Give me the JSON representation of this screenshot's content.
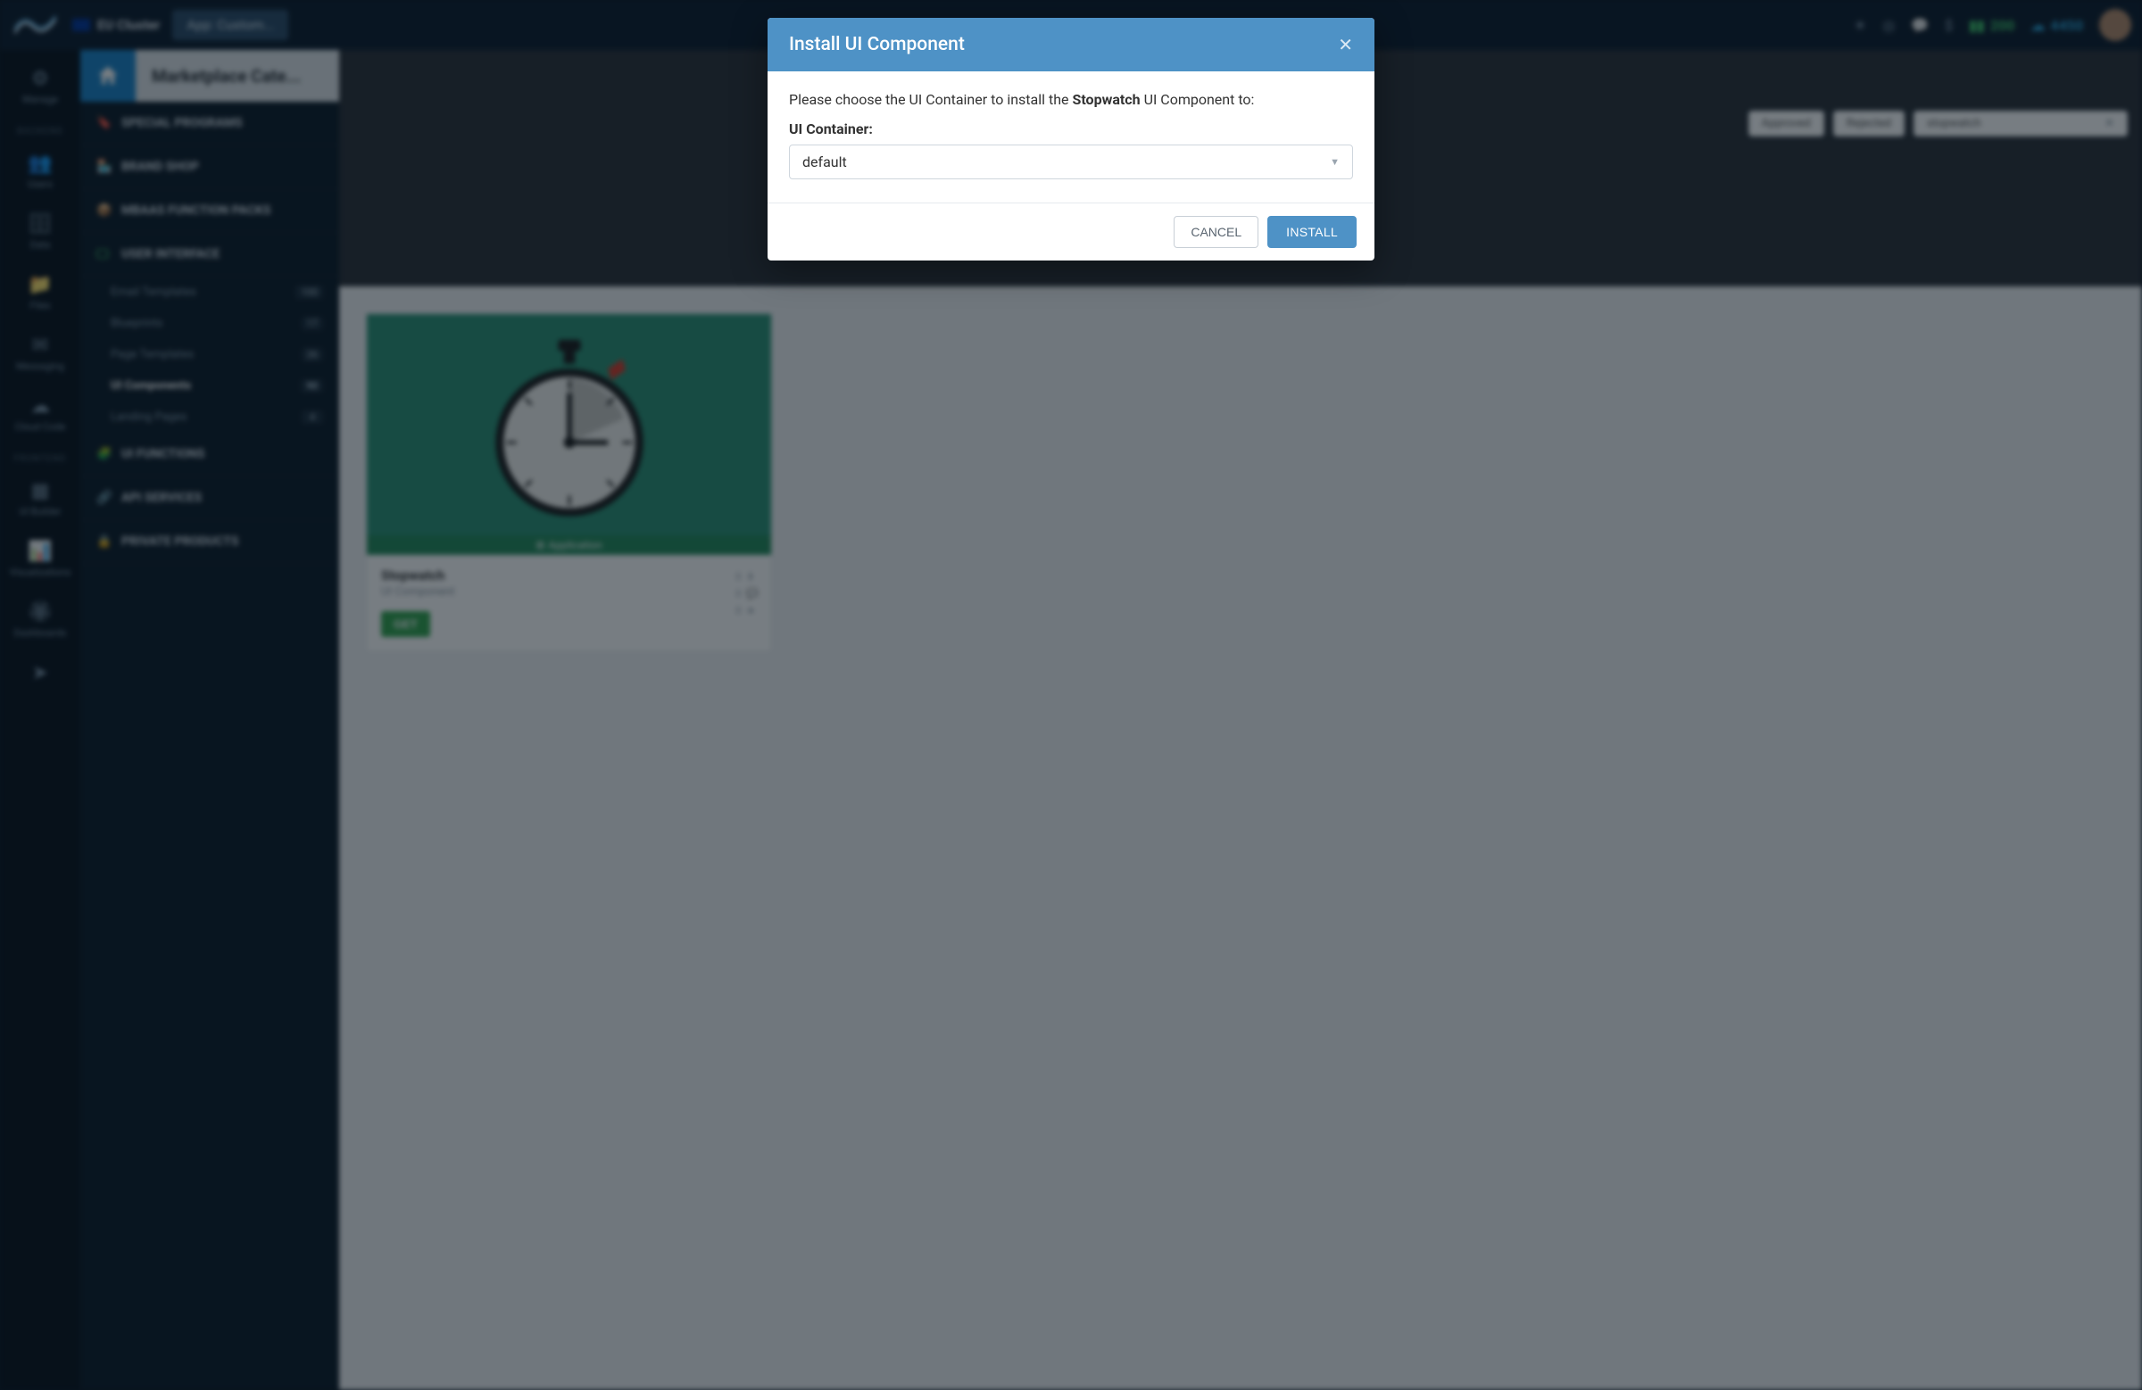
{
  "topbar": {
    "cluster": "EU Cluster",
    "crumb_app_label": "App: Custom...",
    "credit1": "200",
    "credit2": "4450"
  },
  "rail": {
    "section_backend": "BACKEND",
    "section_frontend": "FRONTEND",
    "items": [
      {
        "label": "Manage"
      },
      {
        "label": "Users"
      },
      {
        "label": "Data"
      },
      {
        "label": "Files"
      },
      {
        "label": "Messaging"
      },
      {
        "label": "Cloud Code"
      },
      {
        "label": "UI Builder"
      },
      {
        "label": "Visualizations"
      },
      {
        "label": "Dashboards"
      }
    ]
  },
  "sidebar": {
    "page_title": "Marketplace Cate...",
    "groups": {
      "special_programs": "SPECIAL PROGRAMS",
      "brand_shop": "BRAND SHOP",
      "mbaas_packs": "MBAAS FUNCTION PACKS",
      "user_interface": "USER INTERFACE",
      "ui_functions": "UI FUNCTIONS",
      "api_services": "API SERVICES",
      "private_products": "PRIVATE PRODUCTS"
    },
    "ui_subitems": [
      {
        "label": "Email Templates",
        "count": "100"
      },
      {
        "label": "Blueprints",
        "count": "17"
      },
      {
        "label": "Page Templates",
        "count": "26"
      },
      {
        "label": "UI Components",
        "count": "90"
      },
      {
        "label": "Landing Pages",
        "count": "4"
      }
    ]
  },
  "filters": {
    "approved": "Approved",
    "rejected": "Rejected",
    "search_value": "stopwatch"
  },
  "card": {
    "title": "Stopwatch",
    "type": "UI Component",
    "get_label": "GET",
    "app_tag": "Application",
    "stat_downloads": "0",
    "stat_comments": "0",
    "stat_rating": "0"
  },
  "modal": {
    "title": "Install UI Component",
    "body_prefix": "Please choose the UI Container to install the ",
    "body_component": "Stopwatch",
    "body_suffix": " UI Component to:",
    "container_label": "UI Container:",
    "dropdown_value": "default",
    "cancel": "CANCEL",
    "install": "INSTALL"
  }
}
